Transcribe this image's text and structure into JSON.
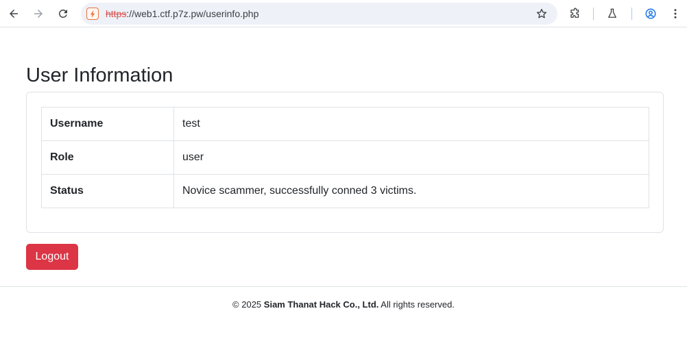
{
  "browser": {
    "url_scheme": "https",
    "url_rest": "://web1.ctf.p7z.pw/userinfo.php"
  },
  "page": {
    "title": "User Information",
    "rows": [
      {
        "label": "Username",
        "value": "test"
      },
      {
        "label": "Role",
        "value": "user"
      },
      {
        "label": "Status",
        "value": "Novice scammer, successfully conned 3 victims."
      }
    ],
    "logout_label": "Logout"
  },
  "footer": {
    "prefix": "© 2025",
    "company": "Siam Thanat Hack Co., Ltd.",
    "suffix": "All rights reserved."
  },
  "colors": {
    "danger": "#dc3545",
    "border": "#dee2e6",
    "omnibox_bg": "#eef1f8",
    "profile_accent": "#1a73e8"
  }
}
